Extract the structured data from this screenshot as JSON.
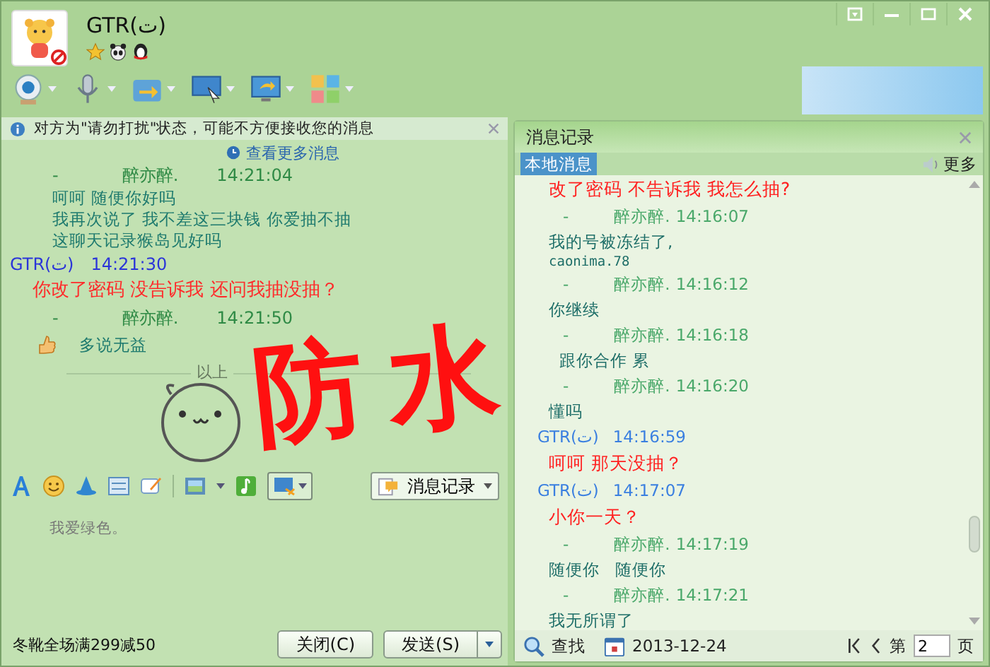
{
  "contact": {
    "name": "GTR(ت)",
    "do_not_disturb": true
  },
  "notice": {
    "text": "对方为\"请勿打扰\"状态，可能不方便接收您的消息"
  },
  "chat": {
    "more_link": "查看更多消息",
    "messages": [
      {
        "kind": "peer-header",
        "dash": "-",
        "sender": "醉亦醉.",
        "time": "14:21:04"
      },
      {
        "kind": "peer-text",
        "text": "呵呵  随便你好吗"
      },
      {
        "kind": "peer-text",
        "text": "我再次说了 我不差这三块钱 你爱抽不抽"
      },
      {
        "kind": "peer-text",
        "text": "这聊天记录猴岛见好吗"
      },
      {
        "kind": "self-header",
        "sender": "GTR(ت)",
        "time": "14:21:30"
      },
      {
        "kind": "self-text",
        "text": "你改了密码 没告诉我 还问我抽没抽？"
      },
      {
        "kind": "peer-header",
        "dash": "-",
        "sender": "醉亦醉.",
        "time": "14:21:50"
      },
      {
        "kind": "thumb-text",
        "text": "多说无益"
      }
    ],
    "history_divider": "以上"
  },
  "annotation": "防水",
  "input": {
    "value": "我爱绿色。"
  },
  "history_button": "消息记录",
  "promo": "冬靴全场满299减50",
  "buttons": {
    "close": "关闭(C)",
    "send": "发送(S)"
  },
  "history": {
    "title": "消息记录",
    "tab": "本地消息",
    "more": "更多",
    "messages": [
      {
        "kind": "self-text",
        "text": "改了密码 不告诉我 我怎么抽?"
      },
      {
        "kind": "peer-header",
        "dash": "-",
        "sender": "醉亦醉.",
        "time": "14:16:07"
      },
      {
        "kind": "peer-text",
        "text": "我的号被冻结了,"
      },
      {
        "kind": "code-text",
        "text": "caonima.78"
      },
      {
        "kind": "peer-header",
        "dash": "-",
        "sender": "醉亦醉.",
        "time": "14:16:12"
      },
      {
        "kind": "peer-text",
        "text": "你继续"
      },
      {
        "kind": "peer-header",
        "dash": "-",
        "sender": "醉亦醉.",
        "time": "14:16:18"
      },
      {
        "kind": "peer-text",
        "text": "  跟你合作 累"
      },
      {
        "kind": "peer-header",
        "dash": "-",
        "sender": "醉亦醉.",
        "time": "14:16:20"
      },
      {
        "kind": "peer-text",
        "text": "懂吗"
      },
      {
        "kind": "self-header",
        "sender": "GTR(ت)",
        "time": "14:16:59"
      },
      {
        "kind": "self-text",
        "text": "呵呵  那天没抽？"
      },
      {
        "kind": "self-header",
        "sender": "GTR(ت)",
        "time": "14:17:07"
      },
      {
        "kind": "self-text",
        "text": "小你一天？"
      },
      {
        "kind": "peer-header",
        "dash": "-",
        "sender": "醉亦醉.",
        "time": "14:17:19"
      },
      {
        "kind": "peer-text",
        "text": "随便你   随便你"
      },
      {
        "kind": "peer-header",
        "dash": "-",
        "sender": "醉亦醉.",
        "time": "14:17:21"
      },
      {
        "kind": "peer-text",
        "text": "我无所谓了"
      }
    ],
    "search": "查找",
    "date": "2013-12-24",
    "page_prefix": "第",
    "page": "2",
    "page_suffix": "页"
  }
}
